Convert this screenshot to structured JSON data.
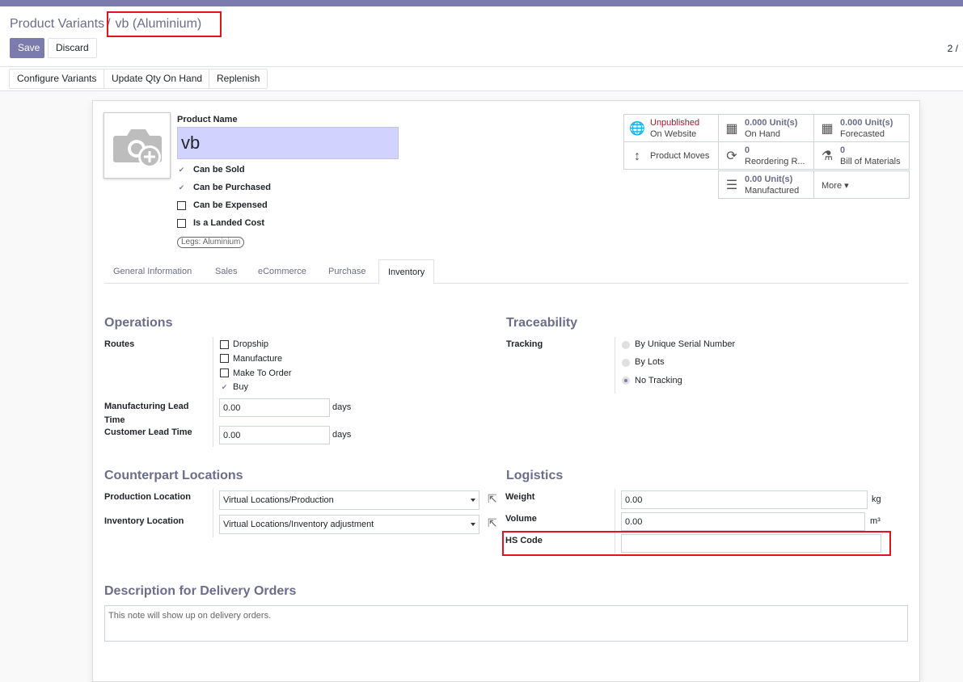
{
  "breadcrumb": {
    "parent": "Product Variants",
    "separator": "/",
    "current": "vb (Aluminium)"
  },
  "buttons": {
    "save": "Save",
    "discard": "Discard"
  },
  "pager": "2 /",
  "status_buttons": {
    "configure": "Configure Variants",
    "update_qty": "Update Qty On Hand",
    "replenish": "Replenish"
  },
  "product": {
    "name_label": "Product Name",
    "name_value": "vb",
    "can_be_sold": "Can be Sold",
    "can_be_purchased": "Can be Purchased",
    "can_be_expensed": "Can be Expensed",
    "is_landed_cost": "Is a Landed Cost",
    "variant_tag": "Legs: Aluminium"
  },
  "smart_buttons": {
    "website_1": "Unpublished",
    "website_2": "On Website",
    "onhand_1": "0.000 Unit(s)",
    "onhand_2": "On Hand",
    "forecast_1": "0.000 Unit(s)",
    "forecast_2": "Forecasted",
    "moves": "Product Moves",
    "reorder_1": "0",
    "reorder_2": "Reordering R...",
    "bom_1": "0",
    "bom_2": "Bill of Materials",
    "manuf_1": "0.00 Unit(s)",
    "manuf_2": "Manufactured",
    "more": "More"
  },
  "tabs": [
    "General Information",
    "Sales",
    "eCommerce",
    "Purchase",
    "Inventory"
  ],
  "operations": {
    "title": "Operations",
    "routes_label": "Routes",
    "routes": [
      "Dropship",
      "Manufacture",
      "Make To Order",
      "Buy"
    ],
    "mfg_lead_label_1": "Manufacturing Lead",
    "mfg_lead_label_2": "Time",
    "mfg_lead_value": "0.00",
    "customer_lead_label": "Customer Lead Time",
    "customer_lead_value": "0.00",
    "days": "days"
  },
  "traceability": {
    "title": "Traceability",
    "tracking_label": "Tracking",
    "options": [
      "By Unique Serial Number",
      "By Lots",
      "No Tracking"
    ]
  },
  "counterpart": {
    "title": "Counterpart Locations",
    "production_label": "Production Location",
    "production_value": "Virtual Locations/Production",
    "inventory_label": "Inventory Location",
    "inventory_value": "Virtual Locations/Inventory adjustment"
  },
  "logistics": {
    "title": "Logistics",
    "weight_label": "Weight",
    "weight_value": "0.00",
    "weight_unit": "kg",
    "volume_label": "Volume",
    "volume_value": "0.00",
    "volume_unit": "m³",
    "hs_label": "HS Code",
    "hs_value": ""
  },
  "delivery": {
    "title": "Description for Delivery Orders",
    "placeholder": "This note will show up on delivery orders."
  }
}
